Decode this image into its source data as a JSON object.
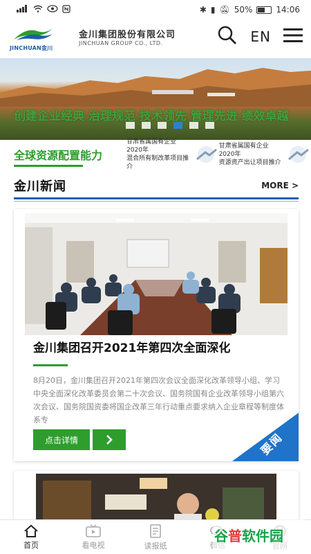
{
  "statusbar": {
    "left_icons": [
      "signal-icon",
      "wifi-icon",
      "eye-icon",
      "nfc-icon"
    ],
    "signal_text": "⁴⁶",
    "battery": "50%",
    "time": "14:06"
  },
  "header": {
    "logo_text": "JINCHUAN金川",
    "company_cn": "金川集团股份有限公司",
    "company_en": "JINCHUAN GROUP CO., LTD.",
    "lang": "EN"
  },
  "banner": {
    "slogan": "创建企业经典 治理规范 技术领先 管理先进 绩效卓越",
    "dots": 6,
    "active_dot": 4
  },
  "ticker": {
    "title": "全球资源配置能力",
    "items": [
      {
        "line1": "甘肃省属国有企业2020年",
        "line2": "混合所有制改革项目推介"
      },
      {
        "line1": "甘肃省属国有企业2020年",
        "line2": "资源资产出让项目推介"
      }
    ]
  },
  "section": {
    "title": "金川新闻",
    "more": "MORE >"
  },
  "news": {
    "title": "金川集团召开2021年第四次全面深化",
    "body": "8月20日，金川集团召开2021年第四次会议全面深化改革领导小组、学习中央全面深化改革委员会第二十次会议、国务院国有企业改革领导小组第六次会议、国务院国资委将国企改革三年行动重点要求纳入企业章程等制度体系专",
    "detail_button": "点击详情",
    "ribbon": "要闻"
  },
  "bottom_nav": [
    {
      "label": "首页",
      "icon": "home-icon"
    },
    {
      "label": "看电视",
      "icon": "tv-icon"
    },
    {
      "label": "读报纸",
      "icon": "newspaper-icon"
    },
    {
      "label": "微信",
      "icon": "wechat-icon"
    },
    {
      "label": "官网",
      "icon": "globe-icon"
    }
  ],
  "watermark": {
    "text_green": "谷",
    "text_red": "普",
    "text_rest": "软件园"
  },
  "colors": {
    "brand_green": "#2e9d2e",
    "brand_blue": "#1a5fa8",
    "ribbon_blue": "#1f73c9"
  }
}
